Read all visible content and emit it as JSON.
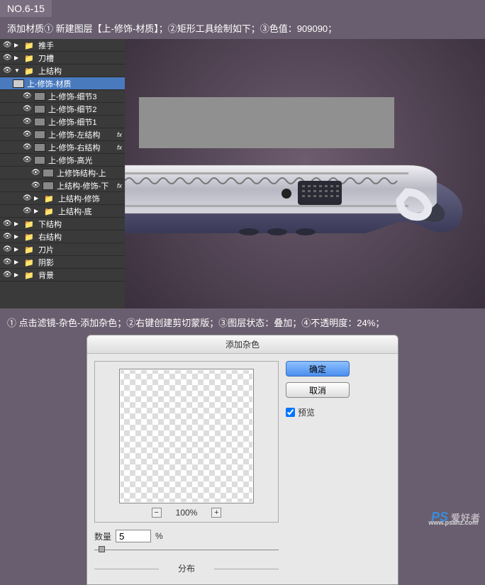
{
  "header": {
    "badge": "NO.6-15"
  },
  "line1": "添加材质① 新建图层【上-修饰-材质】；②矩形工具绘制如下；③色值：909090；",
  "line2": "① 点击滤镜-杂色-添加杂色；②右键创建剪切蒙版；③图层状态：叠加；④不透明度：24%；",
  "layers": {
    "l0": "推手",
    "l1": "刀槽",
    "l2": "上结构",
    "l3": "上-修饰-材质",
    "l4": "上-修饰-细节3",
    "l5": "上-修饰-细节2",
    "l6": "上-修饰-细节1",
    "l7": "上-修饰-左结构",
    "l8": "上-修饰-右结构",
    "l9": "上-修饰-高光",
    "l10": "上修饰结构-上",
    "l11": "上结构-修饰-下",
    "l12": "上结构-修饰",
    "l13": "上结构-底",
    "l14": "下结构",
    "l15": "右结构",
    "l16": "刀片",
    "l17": "阴影",
    "l18": "背景"
  },
  "fx_label": "fx",
  "dialog": {
    "title": "添加杂色",
    "ok": "确定",
    "cancel": "取消",
    "preview": "预览",
    "zoom": "100%",
    "amount_label": "数量",
    "amount_value": "5",
    "amount_unit": "%",
    "distribute": "分布"
  },
  "watermark": {
    "ps": "PS",
    "chars": "爱好者",
    "domain": "www.psahz.com"
  }
}
